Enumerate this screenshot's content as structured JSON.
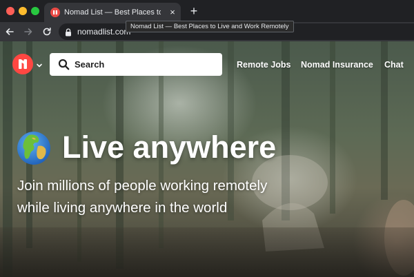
{
  "browser": {
    "tab_title": "Nomad List — Best Places to Li",
    "tab_close": "×",
    "new_tab": "+",
    "url": "nomadlist.com",
    "tooltip": "Nomad List — Best Places to Live and Work Remotely"
  },
  "header": {
    "search_placeholder": "Search",
    "nav": [
      {
        "label": "Remote Jobs"
      },
      {
        "label": "Nomad Insurance"
      },
      {
        "label": "Chat"
      }
    ]
  },
  "hero": {
    "title": "Live anywhere",
    "subtitle_line1": "Join millions of people working remotely",
    "subtitle_line2": "while living anywhere in the world"
  },
  "colors": {
    "brand": "#ff4742",
    "chrome_dark": "#202124",
    "chrome_mid": "#35363a",
    "text_light": "#e8eaed"
  },
  "icons": [
    "nomadlist-logo-icon",
    "chevron-down-icon",
    "search-icon",
    "globe-icon",
    "lock-icon",
    "back-arrow-icon",
    "forward-arrow-icon",
    "reload-icon",
    "close-icon",
    "plus-icon"
  ]
}
